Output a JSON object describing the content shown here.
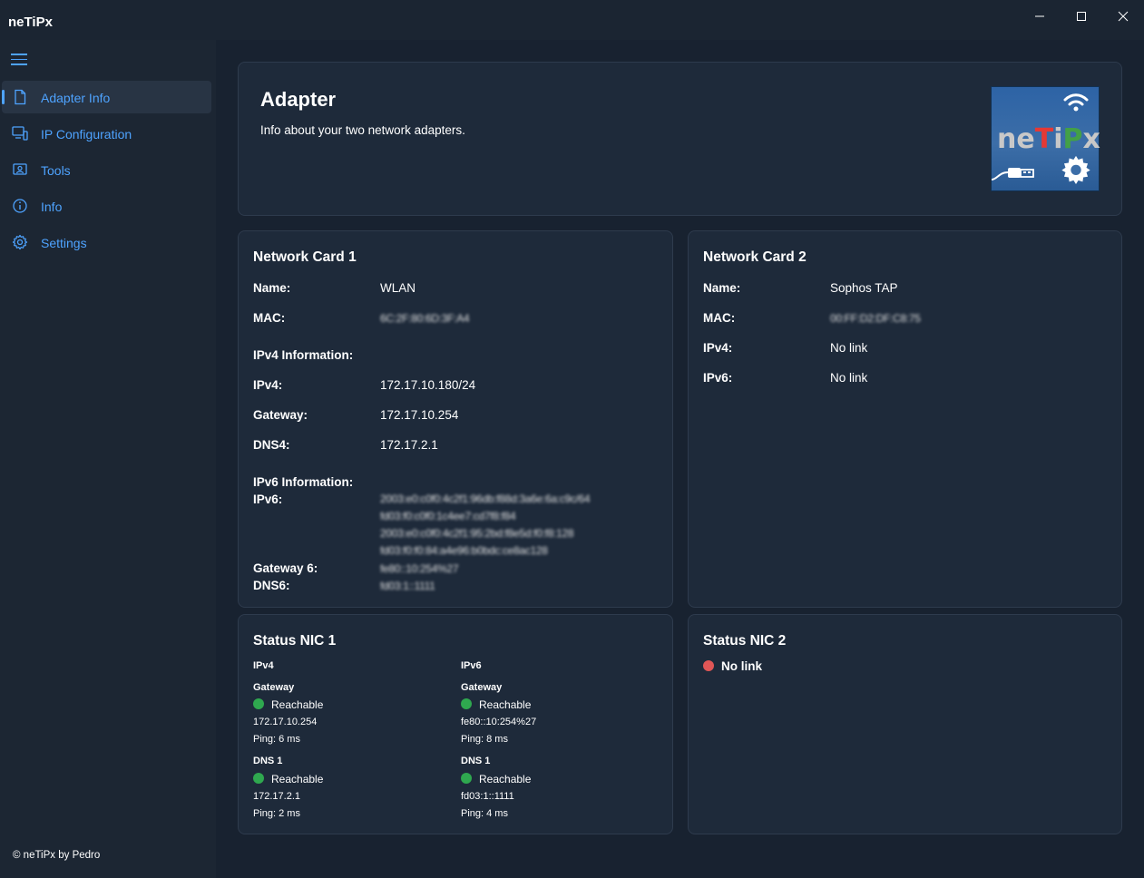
{
  "window": {
    "title": "neTiPx",
    "minimize_glyph": "—",
    "maximize_glyph": "☐",
    "close_glyph": "✕"
  },
  "sidebar": {
    "items": [
      {
        "label": "Adapter Info",
        "icon": "document-icon",
        "active": true
      },
      {
        "label": "IP Configuration",
        "icon": "monitor-network-icon",
        "active": false
      },
      {
        "label": "Tools",
        "icon": "toolbox-icon",
        "active": false
      },
      {
        "label": "Info",
        "icon": "info-icon",
        "active": false
      },
      {
        "label": "Settings",
        "icon": "gear-icon",
        "active": false
      }
    ],
    "footer": "© neTiPx by Pedro"
  },
  "header": {
    "title": "Adapter",
    "subtitle": "Info about your two network adapters.",
    "logo": {
      "ne": "ne",
      "t": "T",
      "i": "i",
      "p": "P",
      "x": "x"
    }
  },
  "card1": {
    "title": "Network Card 1",
    "name_label": "Name:",
    "name_value": "WLAN",
    "mac_label": "MAC:",
    "mac_value": "6C:2F:80:6D:3F:A4",
    "ipv4_section": "IPv4 Information:",
    "ipv4_label": "IPv4:",
    "ipv4_value": "172.17.10.180/24",
    "gateway_label": "Gateway:",
    "gateway_value": "172.17.10.254",
    "dns4_label": "DNS4:",
    "dns4_value": "172.17.2.1",
    "ipv6_section": "IPv6 Information:",
    "ipv6_label": "IPv6:",
    "ipv6_values": [
      "2003:e0:c0f0:4c2f1:96db:f88d:3a6e:6a:c9c/64",
      "fd03:f0:c0f0:1c4ee7:cd7f8:f84",
      "2003:e0:c0f0:4c2f1:95:2bd:f8e5d:f0:f8:128",
      "fd03:f0:f0:84:a4e96:b0bdc:ce8ac128"
    ],
    "gateway6_label": "Gateway 6:",
    "gateway6_value": "fe80::10:254%27",
    "dns6_label": "DNS6:",
    "dns6_value": "fd03:1::1111"
  },
  "card2": {
    "title": "Network Card 2",
    "name_label": "Name:",
    "name_value": "Sophos TAP",
    "mac_label": "MAC:",
    "mac_value": "00:FF:D2:DF:C8:75",
    "ipv4_label": "IPv4:",
    "ipv4_value": "No link",
    "ipv6_label": "IPv6:",
    "ipv6_value": "No link"
  },
  "status1": {
    "title": "Status NIC 1",
    "ipv4": {
      "heading": "IPv4",
      "gateway": {
        "heading": "Gateway",
        "status": "Reachable",
        "address": "172.17.10.254",
        "ping": "Ping: 6 ms"
      },
      "dns": {
        "heading": "DNS 1",
        "status": "Reachable",
        "address": "172.17.2.1",
        "ping": "Ping: 2 ms"
      }
    },
    "ipv6": {
      "heading": "IPv6",
      "gateway": {
        "heading": "Gateway",
        "status": "Reachable",
        "address": "fe80::10:254%27",
        "ping": "Ping: 8 ms"
      },
      "dns": {
        "heading": "DNS 1",
        "status": "Reachable",
        "address": "fd03:1::1111",
        "ping": "Ping: 4 ms"
      }
    }
  },
  "status2": {
    "title": "Status NIC 2",
    "status": "No link"
  },
  "colors": {
    "accent": "#4ea3ff",
    "ok": "#2fa84f",
    "error": "#e05656",
    "logo_red": "#e53935",
    "logo_green": "#43a047",
    "logo_gray": "#c8c8c8"
  }
}
